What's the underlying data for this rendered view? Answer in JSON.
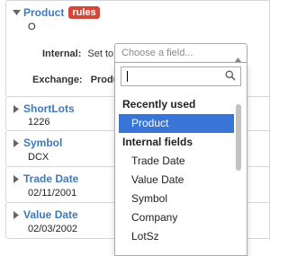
{
  "panels": [
    {
      "title": "Product",
      "badge": "rules",
      "value": "O",
      "expanded": true
    },
    {
      "title": "ShortLots",
      "value": "1226",
      "expanded": false
    },
    {
      "title": "Symbol",
      "value": "DCX",
      "expanded": false
    },
    {
      "title": "Trade Date",
      "value": "02/11/2001",
      "expanded": false
    },
    {
      "title": "Value Date",
      "value": "02/03/2002",
      "expanded": false
    }
  ],
  "rules": {
    "internal_label": "Internal:",
    "set_to": "Set to",
    "exchange_label": "Exchange:",
    "exchange_value": "Produ"
  },
  "select": {
    "placeholder": "Choose a field...",
    "search_value": "",
    "groups": [
      {
        "label": "Recently used",
        "options": [
          "Product"
        ]
      },
      {
        "label": "Internal fields",
        "options": [
          "Trade Date",
          "Value Date",
          "Symbol",
          "Company",
          "LotSz"
        ]
      }
    ],
    "highlighted": "Product"
  },
  "colors": {
    "title_blue": "#3a7bbf",
    "badge_red": "#d2493b",
    "highlight_blue": "#3875d7"
  }
}
